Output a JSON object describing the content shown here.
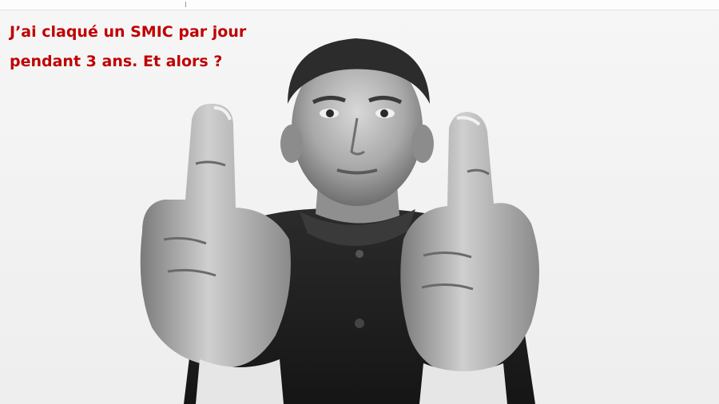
{
  "caption": {
    "line1": "J’ai claqué un SMIC par jour",
    "line2": "pendant 3 ans. Et alors ?"
  },
  "colors": {
    "caption_text": "#c00000",
    "background": "#f2f2f2"
  }
}
